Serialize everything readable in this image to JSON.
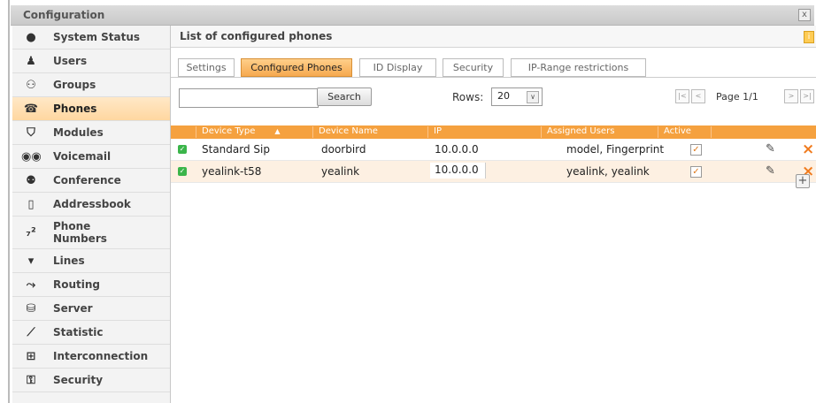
{
  "window": {
    "title": "Configuration",
    "close": "x"
  },
  "sidebar": {
    "items": [
      {
        "label": "System Status",
        "icon": "status-icon"
      },
      {
        "label": "Users",
        "icon": "user-icon"
      },
      {
        "label": "Groups",
        "icon": "groups-icon"
      },
      {
        "label": "Phones",
        "icon": "phone-icon",
        "active": true
      },
      {
        "label": "Modules",
        "icon": "shield-icon"
      },
      {
        "label": "Voicemail",
        "icon": "voicemail-icon"
      },
      {
        "label": "Conference",
        "icon": "conference-icon"
      },
      {
        "label": "Addressbook",
        "icon": "addressbook-icon"
      },
      {
        "label": "Phone",
        "label2": "Numbers",
        "icon": "numbers-icon"
      },
      {
        "label": "Lines",
        "icon": "lines-icon"
      },
      {
        "label": "Routing",
        "icon": "routing-icon"
      },
      {
        "label": "Server",
        "icon": "server-icon"
      },
      {
        "label": "Statistic",
        "icon": "statistic-icon"
      },
      {
        "label": "Interconnection",
        "icon": "interconnection-icon"
      },
      {
        "label": "Security",
        "icon": "lock-icon"
      }
    ]
  },
  "main": {
    "title": "List of configured phones",
    "info": "i",
    "tabs": [
      {
        "label": "Settings"
      },
      {
        "label": "Configured Phones",
        "active": true
      },
      {
        "label": "ID Display"
      },
      {
        "label": "Security"
      },
      {
        "label": "IP-Range restrictions"
      }
    ],
    "search": {
      "value": "",
      "button": "Search"
    },
    "rows": {
      "label": "Rows:",
      "value": "20"
    },
    "pager": {
      "first": "|<",
      "prev": "<",
      "text": "Page 1/1",
      "next": ">",
      "last": ">|"
    },
    "table": {
      "headers": [
        "Device Type",
        "Device Name",
        "IP",
        "Assigned Users",
        "Active"
      ],
      "rows": [
        {
          "type": "Standard Sip",
          "name": "doorbird",
          "ip": "10.0.0.0",
          "users": "model, Fingerprint",
          "active": true
        },
        {
          "type": "yealink-t58",
          "name": "yealink",
          "ip": "10.0.0.0",
          "users": "yealink, yealink",
          "active": true
        }
      ]
    },
    "add": "+"
  },
  "colors": {
    "accent": "#f5a13f",
    "active_row": "#ffd7a0",
    "delete": "#f07b1e"
  }
}
